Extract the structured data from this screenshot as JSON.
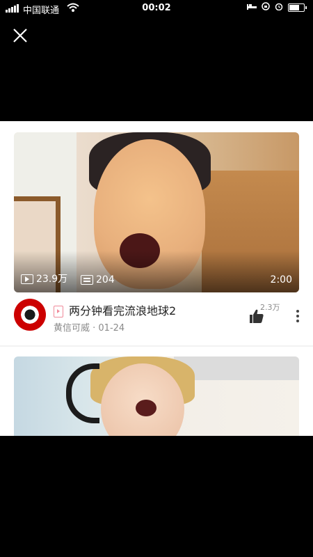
{
  "status_bar": {
    "carrier": "中国联通",
    "time": "00:02"
  },
  "video1": {
    "plays": "23.9万",
    "comments": "204",
    "duration": "2:00",
    "title": "两分钟看完流浪地球2",
    "author_line": "黄信可威 · 01-24",
    "likes": "2.3万"
  },
  "icons": [
    "signal-icon",
    "wifi-icon",
    "bed-icon",
    "alarm-icon",
    "battery-icon",
    "close-icon",
    "play-count-icon",
    "comment-icon",
    "thumbs-up-icon",
    "more-icon",
    "video-tag-icon"
  ]
}
